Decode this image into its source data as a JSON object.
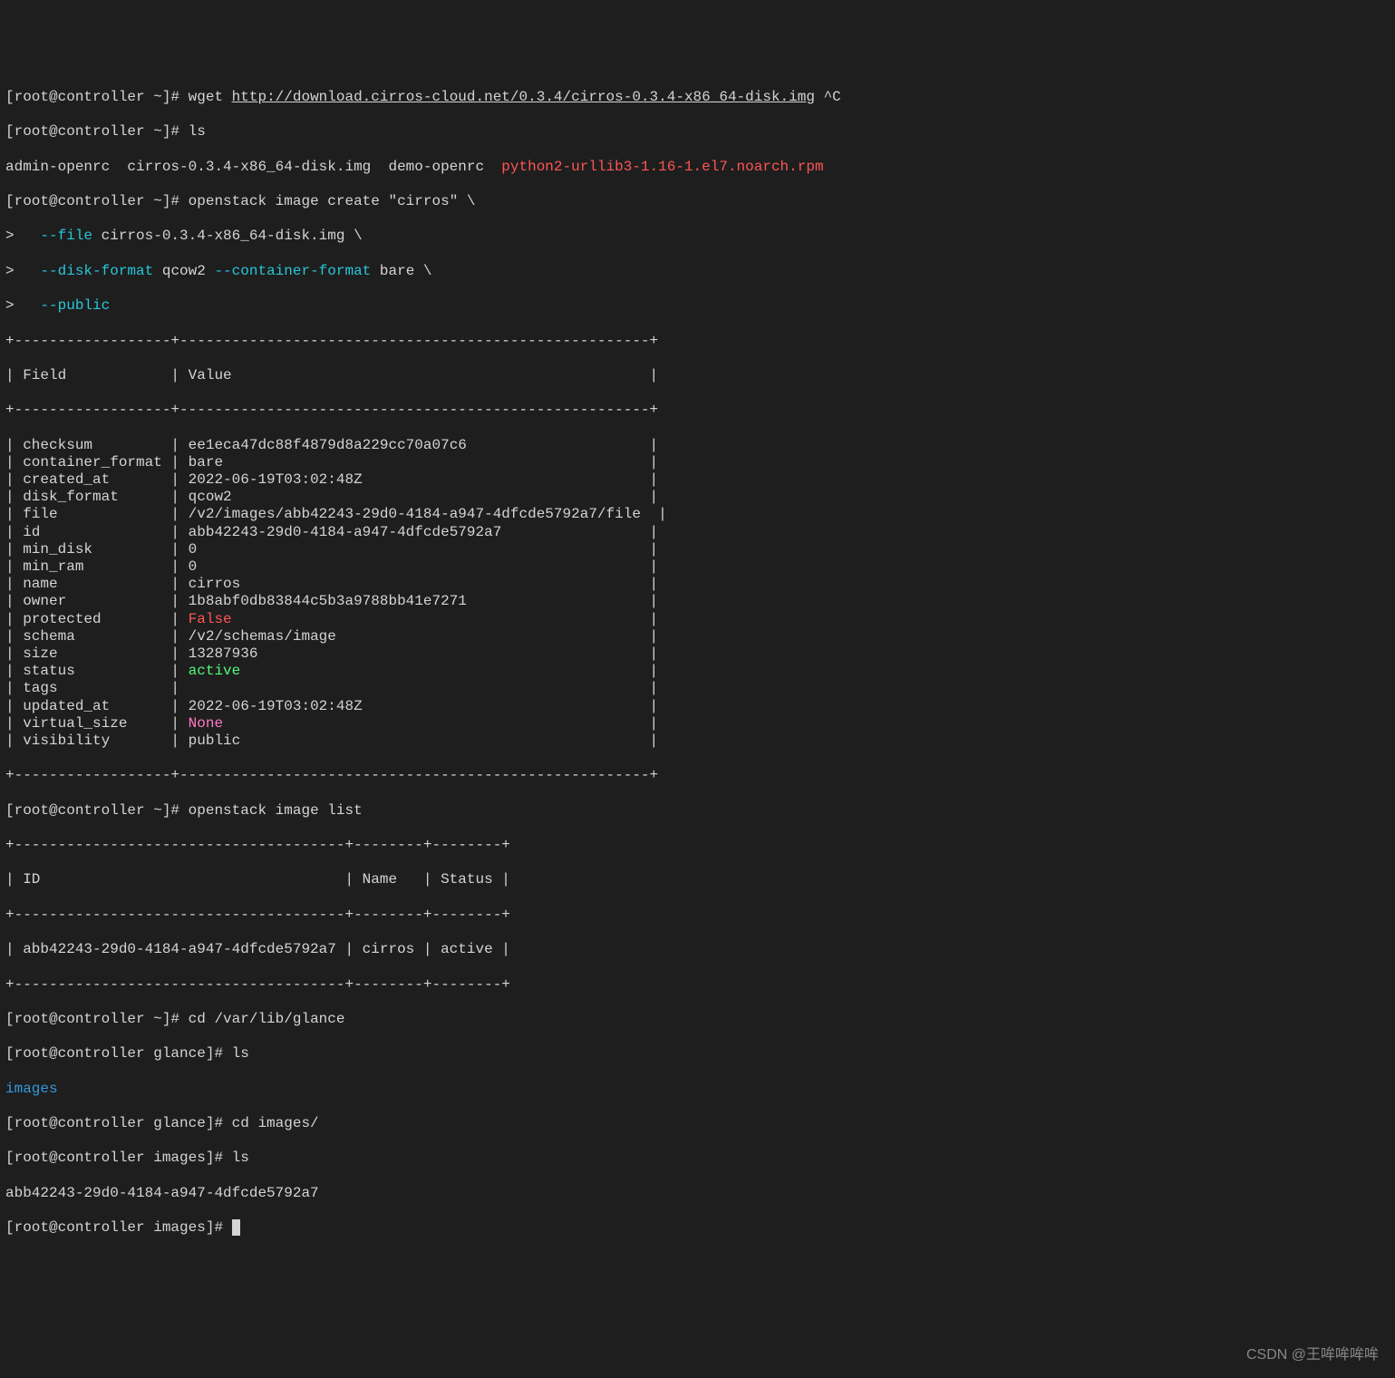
{
  "prompt_tilde": "[root@controller ~]# ",
  "prompt_glance": "[root@controller glance]# ",
  "prompt_images": "[root@controller images]# ",
  "cmd1_pre": "wget ",
  "cmd1_link": "http://download.cirros-cloud.net/0.3.4/cirros-0.3.4-x86_64-disk.img",
  "cmd1_post": " ^C",
  "cmd2": "ls",
  "ls_files_white": "admin-openrc  cirros-0.3.4-x86_64-disk.img  demo-openrc  ",
  "ls_files_red": "python2-urllib3-1.16-1.el7.noarch.rpm",
  "cmd3_l1": "openstack image create \"cirros\" \\",
  "cmd3_l2a": ">   ",
  "cmd3_l2b": "--file",
  "cmd3_l2c": " cirros-0.3.4-x86_64-disk.img \\",
  "cmd3_l3a": ">   ",
  "cmd3_l3b": "--disk-format",
  "cmd3_l3c": " qcow2 ",
  "cmd3_l3d": "--container-format",
  "cmd3_l3e": " bare \\",
  "cmd3_l4a": ">   ",
  "cmd3_l4b": "--public",
  "table1_border_top": "+------------------+------------------------------------------------------+",
  "table1_header": "| Field            | Value                                                |",
  "table1_rows": [
    {
      "field": "checksum",
      "value": "ee1eca47dc88f4879d8a229cc70a07c6",
      "pad": "                    "
    },
    {
      "field": "container_format",
      "value": "bare",
      "pad": "                                                "
    },
    {
      "field": "created_at",
      "value": "2022-06-19T03:02:48Z",
      "pad": "                                "
    },
    {
      "field": "disk_format",
      "value": "qcow2",
      "pad": "                                               "
    },
    {
      "field": "file",
      "value": "/v2/images/abb42243-29d0-4184-a947-4dfcde5792a7/file",
      "pad": " "
    },
    {
      "field": "id",
      "value": "abb42243-29d0-4184-a947-4dfcde5792a7",
      "pad": "                "
    },
    {
      "field": "min_disk",
      "value": "0",
      "pad": "                                                   "
    },
    {
      "field": "min_ram",
      "value": "0",
      "pad": "                                                   "
    },
    {
      "field": "name",
      "value": "cirros",
      "pad": "                                              "
    },
    {
      "field": "owner",
      "value": "1b8abf0db83844c5b3a9788bb41e7271",
      "pad": "                    "
    },
    {
      "field": "protected",
      "value": "False",
      "color": "red",
      "pad": "                                               "
    },
    {
      "field": "schema",
      "value": "/v2/schemas/image",
      "pad": "                                   "
    },
    {
      "field": "size",
      "value": "13287936",
      "pad": "                                            "
    },
    {
      "field": "status",
      "value": "active",
      "color": "green",
      "pad": "                                              "
    },
    {
      "field": "tags",
      "value": "",
      "pad": "                                                    "
    },
    {
      "field": "updated_at",
      "value": "2022-06-19T03:02:48Z",
      "pad": "                                "
    },
    {
      "field": "virtual_size",
      "value": "None",
      "color": "magenta",
      "pad": "                                                "
    },
    {
      "field": "visibility",
      "value": "public",
      "pad": "                                              "
    }
  ],
  "cmd4": "openstack image list",
  "table2_border": "+--------------------------------------+--------+--------+",
  "table2_header": "| ID                                   | Name   | Status |",
  "table2_row": "| abb42243-29d0-4184-a947-4dfcde5792a7 | cirros | active |",
  "cmd5": "cd /var/lib/glance",
  "cmd6": "ls",
  "images_dir": "images",
  "cmd7": "cd images/",
  "cmd8": "ls",
  "image_file": "abb42243-29d0-4184-a947-4dfcde5792a7",
  "watermark": "CSDN @王哞哞哞哞"
}
